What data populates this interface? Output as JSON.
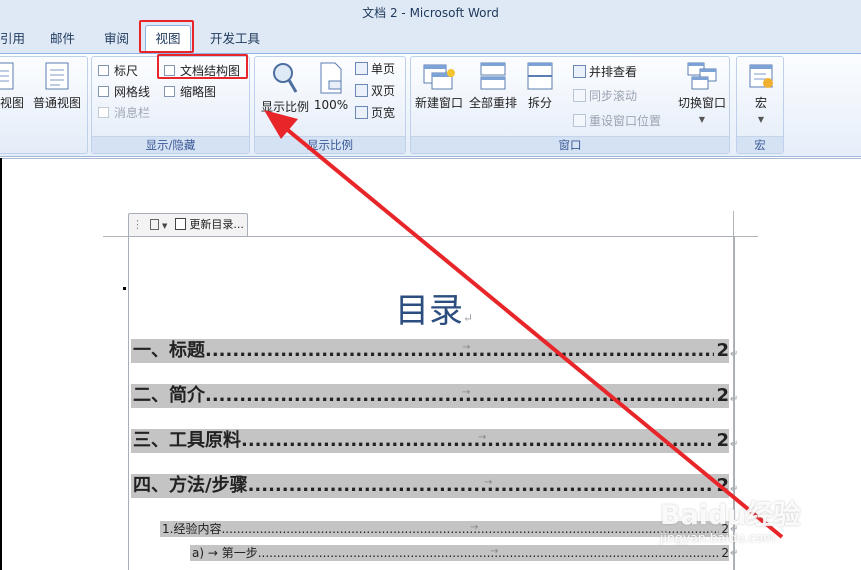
{
  "window": {
    "title": "文档 2 - Microsoft Word"
  },
  "tabs": [
    {
      "label": "引用"
    },
    {
      "label": "邮件"
    },
    {
      "label": "审阅"
    },
    {
      "label": "视图",
      "active": true
    },
    {
      "label": "开发工具"
    }
  ],
  "ribbon": {
    "views": {
      "web_layout_partial": "视图",
      "draft": "普通视图"
    },
    "show_hide": {
      "title": "显示/隐藏",
      "ruler": "标尺",
      "gridlines": "网格线",
      "message_bar": "消息栏",
      "doc_map": "文档结构图",
      "thumbnails": "缩略图"
    },
    "zoom": {
      "title": "显示比例",
      "zoom_btn": "显示比例",
      "hundred": "100%",
      "one_page": "单页",
      "two_pages": "双页",
      "page_width": "页宽"
    },
    "window": {
      "title": "窗口",
      "new_window": "新建窗口",
      "arrange_all": "全部重排",
      "split": "拆分",
      "side_by_side": "并排查看",
      "sync_scroll": "同步滚动",
      "reset_pos": "重设窗口位置",
      "switch_windows": "切换窗口"
    },
    "macros": {
      "title": "宏",
      "macros_btn": "宏"
    }
  },
  "document": {
    "toc_tool_label": "更新目录...",
    "toc_title": "目录",
    "toc_entries": [
      {
        "text": "一、标题",
        "page": "2",
        "level": 1
      },
      {
        "text": "二、简介",
        "page": "2",
        "level": 1
      },
      {
        "text": "三、工具原料",
        "page": "2",
        "level": 1
      },
      {
        "text": "四、方法/步骤",
        "page": "2",
        "level": 1
      },
      {
        "text": "1.经验内容",
        "page": "2",
        "level": 2
      },
      {
        "text": "a) → 第一步",
        "page": "2",
        "level": 3
      }
    ]
  },
  "watermark": {
    "brand": "Baidu经验",
    "url": "jingyan.baidu.com"
  },
  "colors": {
    "highlight": "#e8262a",
    "arrow": "#e8262a",
    "toc_shading": "#c4c4c4",
    "title_blue": "#2c4d80"
  }
}
